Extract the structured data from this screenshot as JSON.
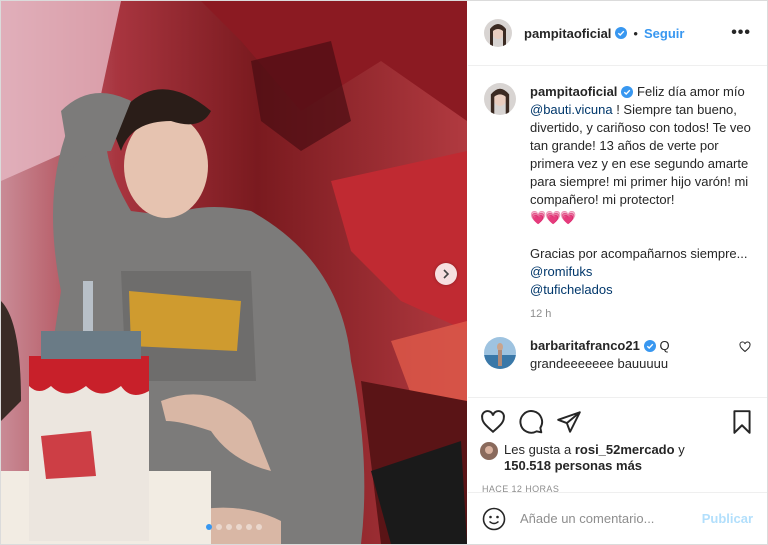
{
  "post": {
    "username": "pampitaoficial",
    "follow_label": "Seguir",
    "separator": "•",
    "more_label": "•••",
    "caption": {
      "text1": "Feliz día amor mío",
      "mention1": "@bauti.vicuna",
      "text2": "! Siempre tan bueno, divertido, y cariñoso con todos! Te veo tan grande! 13 años de verte por primera vez y en ese segundo amarte para siempre! mi primer hijo varón! mi compañero! mi protector!",
      "hearts": "💗💗💗",
      "text3": "Gracias por acompañarnos siempre...",
      "mention2": "@romifuks",
      "mention3": "@tufichelados",
      "time": "12 h"
    },
    "comment": {
      "username": "barbaritafranco21",
      "text": "Q grandeeeeeee bauuuuu"
    },
    "likes": {
      "prefix": "Les gusta a",
      "user": "rosi_52mercado",
      "conj": "y",
      "count": "150.518 personas más"
    },
    "posted_ago": "HACE 12 HORAS",
    "add_comment": {
      "placeholder": "Añade un comentario...",
      "publish_label": "Publicar"
    },
    "carousel": {
      "total": 6,
      "active": 1
    }
  },
  "colors": {
    "accent": "#3897f0",
    "verified": "#3897f0",
    "publish_disabled": "#b2dffc"
  },
  "icons": [
    "verified-badge-icon",
    "ellipsis-icon",
    "chevron-right-icon",
    "heart-icon",
    "comment-icon",
    "share-icon",
    "bookmark-icon",
    "emoji-icon"
  ]
}
